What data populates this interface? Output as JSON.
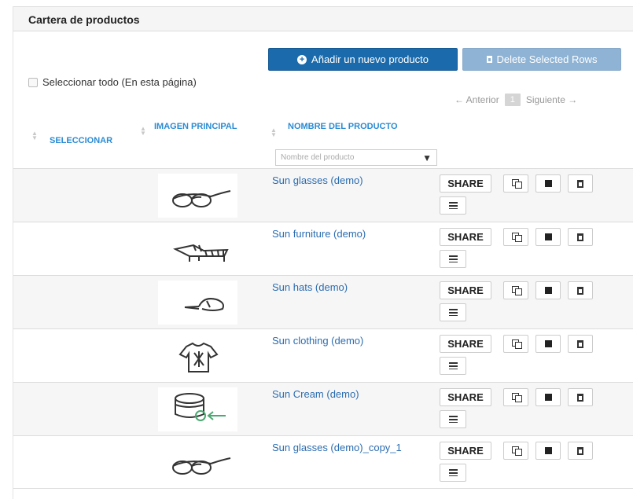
{
  "panel": {
    "title": "Cartera de productos"
  },
  "toolbar": {
    "add_label": "Añadir un nuevo producto",
    "delete_label": "Delete Selected Rows"
  },
  "select_all": {
    "label": "Seleccionar todo (En esta página)"
  },
  "pagination": {
    "prev": "← Anterior",
    "current": "1",
    "next": "Siguiente →"
  },
  "columns": {
    "select": "SELECCIONAR",
    "image": "IMAGEN PRINCIPAL",
    "name": "NOMBRE DEL PRODUCTO"
  },
  "filter": {
    "placeholder": "Nombre del producto"
  },
  "actions": {
    "share_label": "SHARE"
  },
  "products": [
    {
      "name": "Sun glasses (demo)",
      "icon": "sunglasses-image"
    },
    {
      "name": "Sun furniture (demo)",
      "icon": "sunbed-image"
    },
    {
      "name": "Sun hats (demo)",
      "icon": "cap-image"
    },
    {
      "name": "Sun clothing (demo)",
      "icon": "shirt-image"
    },
    {
      "name": "Sun Cream (demo)",
      "icon": "cream-tub-image"
    },
    {
      "name": "Sun glasses (demo)_copy_1",
      "icon": "sunglasses-image"
    }
  ],
  "colors": {
    "primary_button": "#1b6aab",
    "disabled_button": "#8fb3d4",
    "header_text": "#2a8bd2",
    "link_text": "#2b6cb0"
  }
}
